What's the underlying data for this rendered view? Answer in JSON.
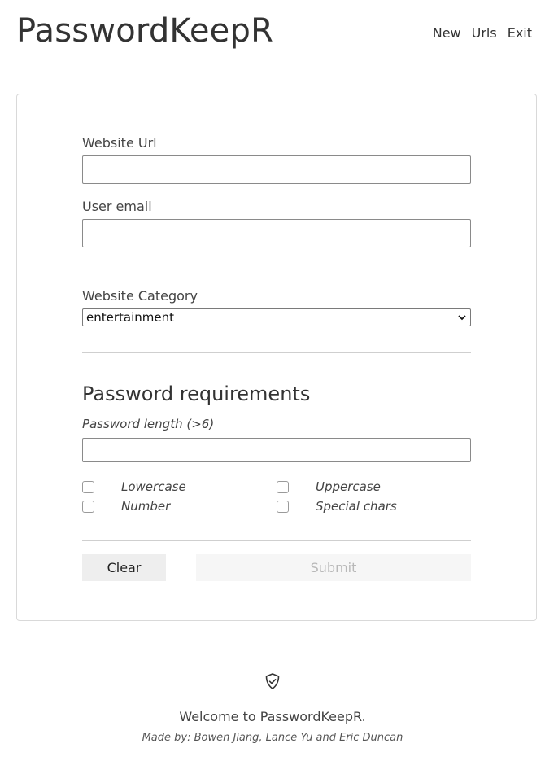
{
  "header": {
    "brand": "PasswordKeepR",
    "nav": {
      "new": "New",
      "urls": "Urls",
      "exit": "Exit"
    }
  },
  "form": {
    "website_url": {
      "label": "Website Url",
      "value": ""
    },
    "user_email": {
      "label": "User email",
      "value": ""
    },
    "category": {
      "label": "Website Category",
      "selected": "entertainment"
    },
    "requirements": {
      "title": "Password requirements",
      "length_label": "Password length (>6)",
      "length_value": "",
      "options": {
        "lowercase": {
          "label": "Lowercase",
          "checked": false
        },
        "uppercase": {
          "label": "Uppercase",
          "checked": false
        },
        "number": {
          "label": "Number",
          "checked": false
        },
        "special": {
          "label": "Special chars",
          "checked": false
        }
      }
    },
    "buttons": {
      "clear": "Clear",
      "submit": "Submit"
    }
  },
  "footer": {
    "icon": "shield-check-icon",
    "welcome": "Welcome to PasswordKeepR.",
    "credits": "Made by: Bowen Jiang, Lance Yu and Eric Duncan"
  },
  "colors": {
    "text": "#333333",
    "border": "#d9d9d9",
    "button_bg": "#eeeeee",
    "disabled_text": "#b8b8b8"
  }
}
